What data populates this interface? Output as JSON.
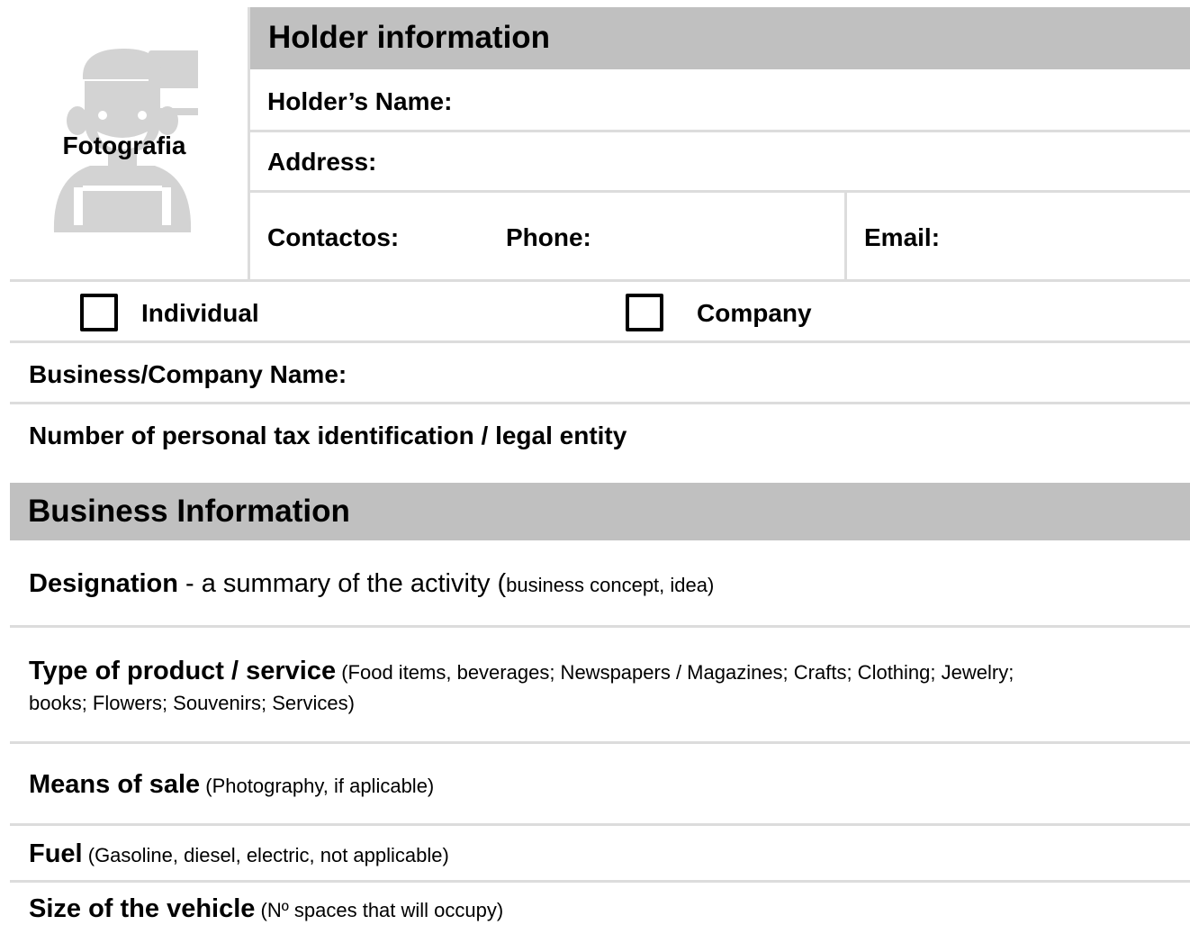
{
  "photo": {
    "label": "Fotografia",
    "icon": "vendor-silhouette-icon"
  },
  "holder": {
    "header": "Holder information",
    "name_label": "Holder’s Name:",
    "address_label": "Address:",
    "contacts_label": "Contactos:",
    "phone_label": "Phone:",
    "email_label": "Email:"
  },
  "entity_type": {
    "individual_label": "Individual",
    "company_label": "Company"
  },
  "business_name_label": "Business/Company Name:",
  "tax_id_label": "Number of personal tax identification / legal entity",
  "business": {
    "header": "Business Information",
    "designation": {
      "label": "Designation",
      "mid": " - a summary of the activity (",
      "hint": "business concept, idea)"
    },
    "product_type": {
      "label": "Type of product / service",
      "hint_line1": " (Food items, beverages; Newspapers / Magazines; Crafts; Clothing; Jewelry;",
      "hint_line2": "books; Flowers; Souvenirs; Services)"
    },
    "means_of_sale": {
      "label": "Means of sale",
      "hint": " (Photography, if aplicable)"
    },
    "fuel": {
      "label": "Fuel",
      "hint": " (Gasoline, diesel, electric, not applicable)"
    },
    "vehicle_size": {
      "label": "Size of the vehicle",
      "hint": " (Nº spaces that will occupy)"
    }
  },
  "colors": {
    "header_bg": "#c0c0c0",
    "rule": "#dcdcdc",
    "icon": "#d3d3d3"
  }
}
